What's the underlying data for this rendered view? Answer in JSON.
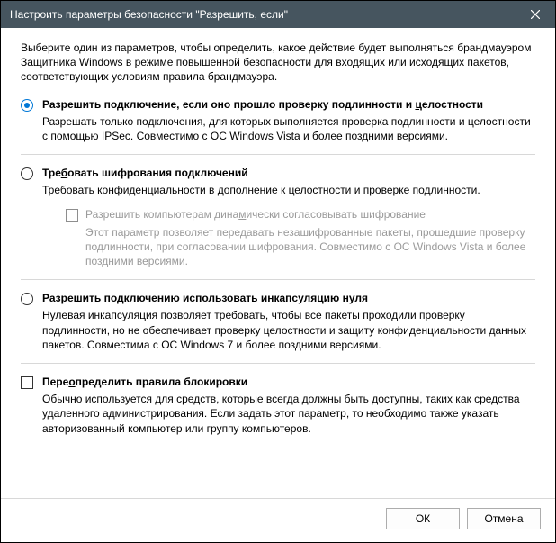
{
  "window": {
    "title": "Настроить параметры безопасности \"Разрешить, если\""
  },
  "intro": "Выберите один из параметров, чтобы определить, какое действие будет выполняться брандмауэром Защитника Windows в режиме повышенной безопасности для входящих или исходящих пакетов, соответствующих условиям правила брандмауэра.",
  "options": {
    "opt1": {
      "title_pre": "Разрешить подключение, если оно прошло проверку подлинности и ",
      "title_ul": "ц",
      "title_post": "елостности",
      "desc": "Разрешать только подключения, для которых выполняется проверка подлинности и целостности с помощью IPSec. Совместимо с ОС Windows Vista и более поздними версиями."
    },
    "opt2": {
      "title_pre": "Тре",
      "title_ul": "б",
      "title_post": "овать шифрования подключений",
      "desc": "Требовать конфиденциальности в дополнение к целостности и проверке подлинности.",
      "sub": {
        "label_pre": "Разрешить компьютерам дина",
        "label_ul": "м",
        "label_post": "ически согласовывать шифрование",
        "desc": "Этот параметр позволяет передавать незашифрованные пакеты, прошедшие проверку подлинности, при согласовании шифрования. Совместимо с ОС Windows Vista и более поздними версиями."
      }
    },
    "opt3": {
      "title_pre": "Разрешить подключению использовать инкапсуляци",
      "title_ul": "ю",
      "title_post": " нуля",
      "desc": "Нулевая инкапсуляция позволяет требовать, чтобы все пакеты проходили проверку подлинности, но не обеспечивает проверку целостности и защиту конфиденциальности данных пакетов. Совместима с ОС Windows 7 и более поздними версиями."
    },
    "opt4": {
      "title_pre": "Пере",
      "title_ul": "о",
      "title_post": "пределить правила блокировки",
      "desc": "Обычно используется для средств, которые всегда должны быть доступны, таких как средства удаленного администрирования. Если задать этот параметр, то необходимо также указать авторизованный компьютер или группу компьютеров."
    }
  },
  "buttons": {
    "ok": "ОК",
    "cancel": "Отмена"
  }
}
